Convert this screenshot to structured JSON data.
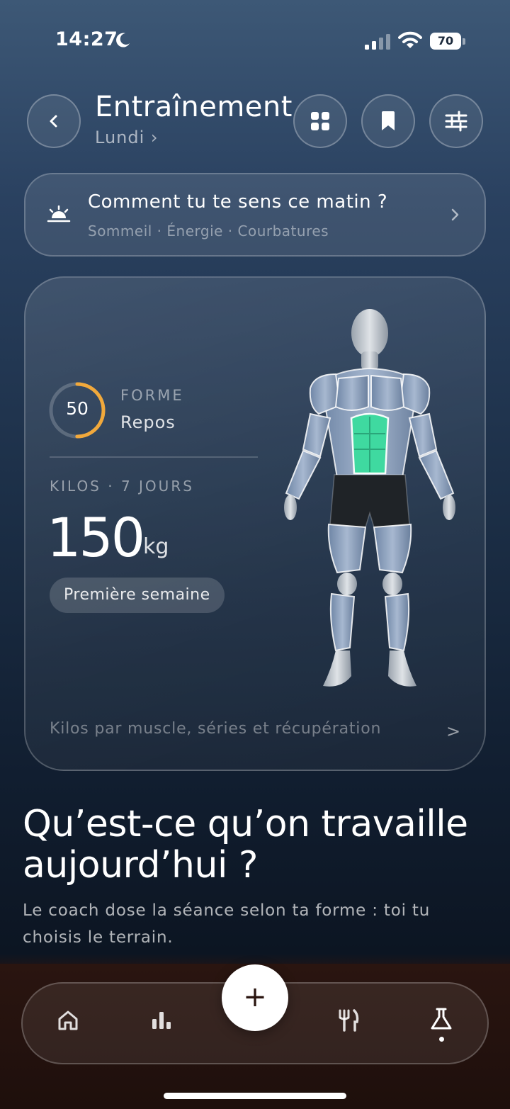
{
  "status_bar": {
    "time": "14:27",
    "battery": "70",
    "icons": [
      "moon-icon",
      "signal-icon",
      "wifi-icon",
      "battery-icon"
    ]
  },
  "header": {
    "title": "Entraînement",
    "subtitle": "Lundi ›",
    "buttons": [
      "back-icon",
      "grid-icon",
      "bookmark-icon",
      "sliders-icon"
    ]
  },
  "mood_card": {
    "title": "Comment tu te sens ce matin ?",
    "subtitle": "Sommeil · Énergie · Courbatures",
    "icon": "sunrise-icon"
  },
  "stats_card": {
    "forme_value": "50",
    "forme_fraction": 0.5,
    "forme_label": "FORME",
    "forme_status": "Repos",
    "kilos_label": "KILOS · 7 JOURS",
    "kilos_value": "150",
    "kilos_unit": "kg",
    "pill": "Première semaine",
    "footer": "Kilos par muscle, séries et récupération",
    "chevron": ">",
    "accent_color": "#f2a93b",
    "highlight_muscle_color": "#3fd9a0"
  },
  "section": {
    "heading": "Qu’est-ce qu’on travaille aujourd’hui ?",
    "subtext": "Le coach dose la séance selon ta forme : toi tu choisis le terrain."
  },
  "nav": {
    "fab": "+",
    "items": [
      "home-icon",
      "stats-icon",
      "fork-knife-icon",
      "flask-icon"
    ],
    "active": "flask-icon"
  }
}
